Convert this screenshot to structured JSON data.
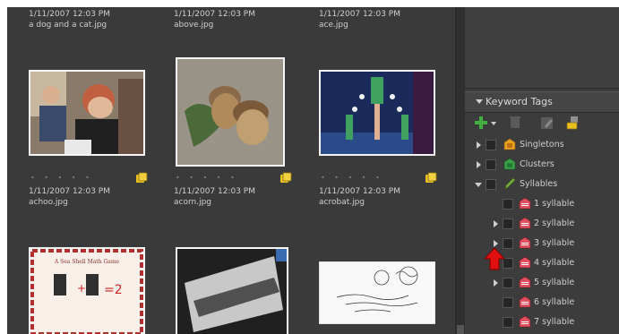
{
  "grid": {
    "row0": [
      {
        "date": "1/11/2007 12:03 PM",
        "filename": "a dog and a cat.jpg"
      },
      {
        "date": "1/11/2007 12:03 PM",
        "filename": "above.jpg"
      },
      {
        "date": "1/11/2007 12:03 PM",
        "filename": "ace.jpg"
      }
    ],
    "row1": [
      {
        "date": "1/11/2007 12:03 PM",
        "filename": "achoo.jpg",
        "rating": "• • • • •"
      },
      {
        "date": "1/11/2007 12:03 PM",
        "filename": "acorn.jpg",
        "rating": "• • • • •"
      },
      {
        "date": "1/11/2007 12:03 PM",
        "filename": "acrobat.jpg",
        "rating": "• • • • •"
      }
    ]
  },
  "panel": {
    "title": "Keyword Tags",
    "tags": [
      {
        "label": "Singletons",
        "icon": "category-tag-icon",
        "color": "#e8a020"
      },
      {
        "label": "Clusters",
        "icon": "category-tag-icon",
        "color": "#3aa04a"
      },
      {
        "label": "Syllables",
        "icon": "pen-tag-icon",
        "color": "#7ab040"
      },
      {
        "label": "1 syllable",
        "icon": "tag-icon",
        "color": "#e05060"
      },
      {
        "label": "2 syllable",
        "icon": "tag-icon",
        "color": "#e05060"
      },
      {
        "label": "3 syllable",
        "icon": "tag-icon",
        "color": "#e05060"
      },
      {
        "label": "4 syllable",
        "icon": "tag-icon",
        "color": "#e05060"
      },
      {
        "label": "5 syllable",
        "icon": "tag-icon",
        "color": "#e05060"
      },
      {
        "label": "6 syllable",
        "icon": "tag-icon",
        "color": "#e05060"
      },
      {
        "label": "7 syllable",
        "icon": "tag-icon",
        "color": "#e05060"
      }
    ]
  },
  "colors": {
    "background": "#3a3a3a",
    "panel": "#3c3c3c",
    "accent_red": "#e01010"
  }
}
